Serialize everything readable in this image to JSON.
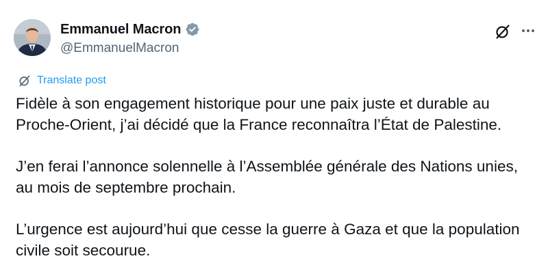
{
  "author": {
    "display_name": "Emmanuel Macron",
    "handle": "@EmmanuelMacron",
    "verified": true
  },
  "actions": {
    "grok_icon": "grok-icon",
    "more_icon": "more-icon"
  },
  "translate": {
    "label": "Translate post"
  },
  "post": {
    "paragraphs": [
      {
        "line1": "Fidèle à son engagement historique pour une paix juste et durable au",
        "line2": "Proche-Orient, j’ai décidé que la France reconnaîtra l’État de Palestine."
      },
      {
        "line1": "J’en ferai l’annonce solennelle à l’Assemblée générale des Nations unies,",
        "line2": "au mois de septembre prochain."
      },
      {
        "line1": "L’urgence est aujourd’hui que cesse la guerre à Gaza et que la population",
        "line2": "civile soit secourue."
      }
    ]
  },
  "colors": {
    "text": "#0f1419",
    "secondary": "#536471",
    "link": "#1d9bf0",
    "verified_badge": "#829aab"
  }
}
